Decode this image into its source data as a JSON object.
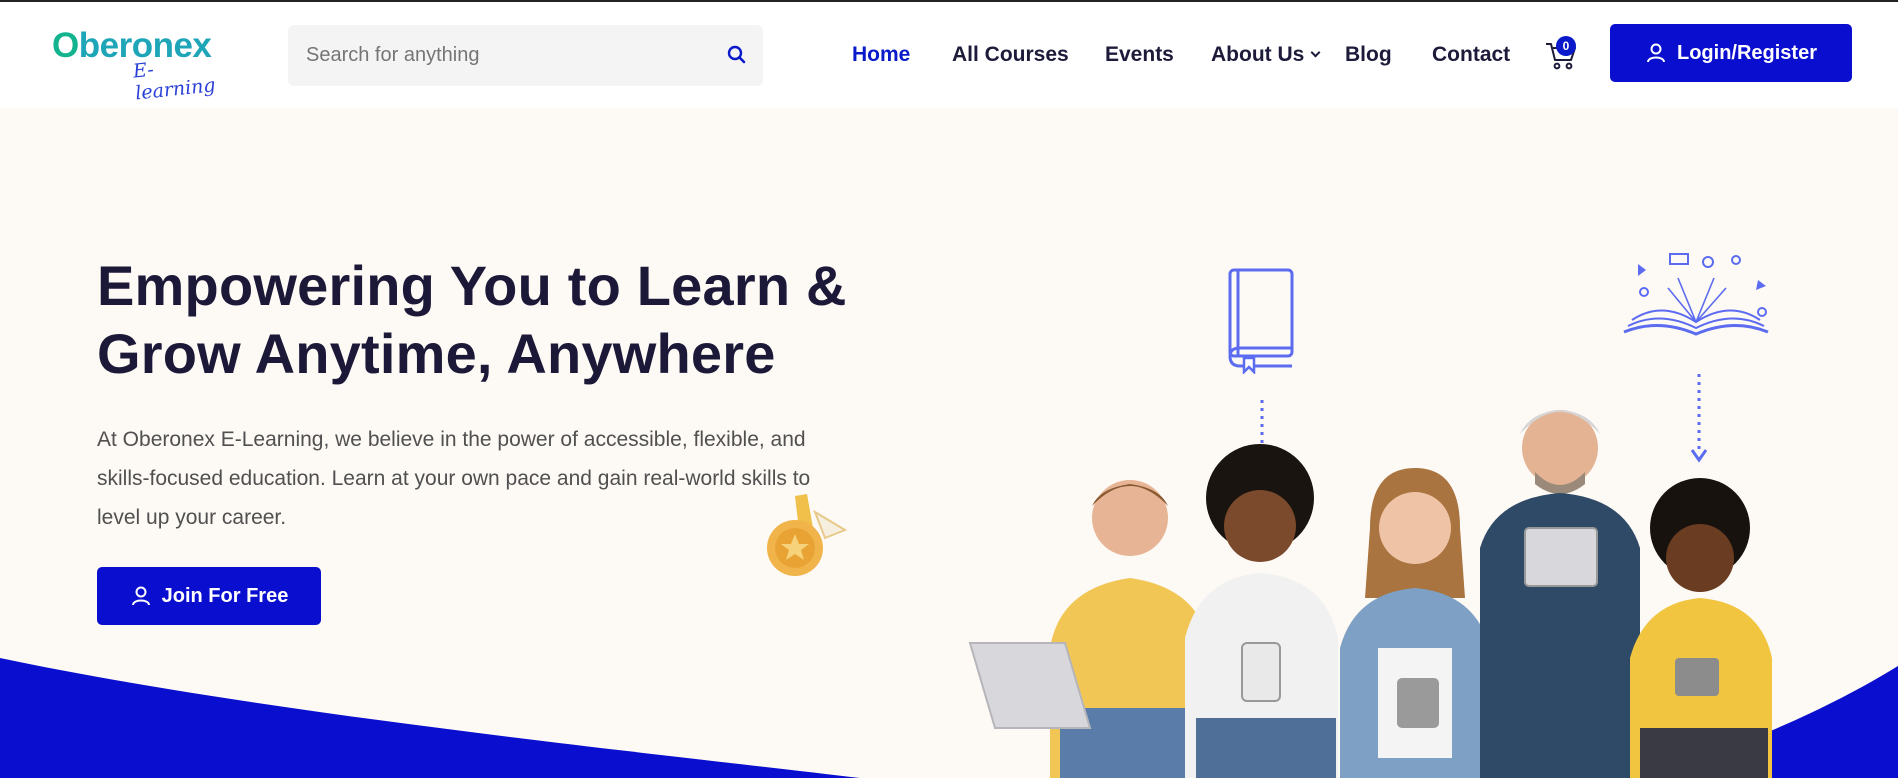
{
  "brand": {
    "name_prefix": "O",
    "name_rest": "beronex",
    "tagline": "E-learning"
  },
  "search": {
    "placeholder": "Search for anything",
    "icon": "search-icon"
  },
  "nav": {
    "items": [
      {
        "label": "Home",
        "active": true
      },
      {
        "label": "All Courses"
      },
      {
        "label": "Events"
      },
      {
        "label": "About Us",
        "has_dropdown": true
      },
      {
        "label": "Blog"
      },
      {
        "label": "Contact"
      }
    ]
  },
  "cart": {
    "count": "0",
    "icon": "cart-icon"
  },
  "login": {
    "label": "Login/Register",
    "icon": "user-icon"
  },
  "hero": {
    "title_line1": "Empowering You to Learn &",
    "title_line2": "Grow Anytime, Anywhere",
    "description": "At Oberonex E-Learning, we believe in the power of accessible, flexible, and skills-focused education. Learn at your own pace and gain real-world skills to level up your career.",
    "cta_label": "Join For Free",
    "cta_icon": "user-icon"
  },
  "colors": {
    "accent": "#0a0ecf",
    "active_nav": "#0a19c9",
    "heading": "#1c1838",
    "hero_bg": "#fdf9f4",
    "illustration_blue": "#5b6cf0"
  }
}
